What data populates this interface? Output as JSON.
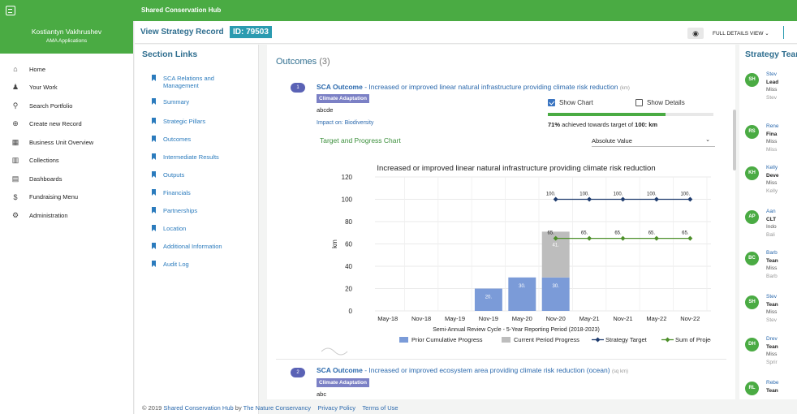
{
  "app": {
    "title": "Shared Conservation Hub"
  },
  "user": {
    "name": "Kostiantyn Vakhrushev",
    "role": "AMA Applications"
  },
  "nav": [
    {
      "label": "Home",
      "icon": "home-icon",
      "glyph": "⌂"
    },
    {
      "label": "Your Work",
      "icon": "person-icon",
      "glyph": "♟"
    },
    {
      "label": "Search Portfolio",
      "icon": "search-icon",
      "glyph": "⚲"
    },
    {
      "label": "Create new Record",
      "icon": "plus-circle-icon",
      "glyph": "⊕"
    },
    {
      "label": "Business Unit Overview",
      "icon": "org-chart-icon",
      "glyph": "▦"
    },
    {
      "label": "Collections",
      "icon": "collections-icon",
      "glyph": "▥"
    },
    {
      "label": "Dashboards",
      "icon": "dashboard-icon",
      "glyph": "▤"
    },
    {
      "label": "Fundraising Menu",
      "icon": "dollar-icon",
      "glyph": "$"
    },
    {
      "label": "Administration",
      "icon": "gear-icon",
      "glyph": "⚙"
    }
  ],
  "header": {
    "title": "View Strategy Record",
    "id_label": "ID: 79503",
    "view_label": "FULL DETAILS VIEW ⌄"
  },
  "section_links": {
    "title": "Section Links",
    "items": [
      "SCA Relations and Management",
      "Summary",
      "Strategic Pillars",
      "Outcomes",
      "Intermediate Results",
      "Outputs",
      "Financials",
      "Partnerships",
      "Location",
      "Additional Information",
      "Audit Log"
    ]
  },
  "outcomes": {
    "heading": "Outcomes",
    "count": "(3)",
    "items": [
      {
        "num": "1",
        "prefix": "SCA Outcome",
        "desc": " - Increased or improved linear natural infrastructure providing climate risk reduction",
        "unit": "(km)",
        "tag": "Climate Adaptation",
        "note": "abcde",
        "impact_label": "Impact on:",
        "impact_value": "Biodiversity",
        "show_chart": "Show Chart",
        "show_details": "Show Details",
        "progress_fraction": 0.71,
        "achieved_pct": "71%",
        "achieved_text": " achieved towards target of ",
        "achieved_target": "100: km",
        "chart_section": "Target and Progress Chart",
        "select_value": "Absolute Value"
      },
      {
        "num": "2",
        "prefix": "SCA Outcome",
        "desc": " - Increased or improved ecosystem area providing climate risk reduction (ocean)",
        "unit": "(sq km)",
        "tag": "Climate Adaptation",
        "note": "abc"
      }
    ]
  },
  "chart_data": {
    "type": "bar",
    "title": "Increased or improved linear natural infrastructure providing climate risk reduction",
    "xlabel": "Semi-Annual Review Cycle - 5-Year Reporting Period (2018-2023)",
    "ylabel": "km",
    "ylim": [
      0,
      120
    ],
    "yticks": [
      "0",
      "20",
      "40",
      "60",
      "80",
      "100",
      "120"
    ],
    "categories": [
      "May-18",
      "Nov-18",
      "May-19",
      "Nov-19",
      "May-20",
      "Nov-20",
      "May-21",
      "Nov-21",
      "May-22",
      "Nov-22"
    ],
    "series": [
      {
        "name": "Prior Cumulative Progress",
        "kind": "bar",
        "color": "#7b9bd8",
        "values": [
          null,
          null,
          null,
          20,
          30,
          30,
          null,
          null,
          null,
          null
        ],
        "labels": [
          "",
          "",
          "",
          "20.",
          "30.",
          "30.",
          "",
          "",
          "",
          ""
        ]
      },
      {
        "name": "Current Period Progress",
        "kind": "bar",
        "color": "#bdbdbd",
        "values": [
          null,
          null,
          null,
          null,
          null,
          41,
          null,
          null,
          null,
          null
        ],
        "labels": [
          "",
          "",
          "",
          "",
          "",
          "41.",
          "",
          "",
          "",
          ""
        ]
      },
      {
        "name": "Strategy Target",
        "kind": "line",
        "color": "#1f3c6e",
        "values": [
          null,
          null,
          null,
          null,
          null,
          100,
          100,
          100,
          100,
          100
        ],
        "labels": [
          "",
          "",
          "",
          "",
          "",
          "100.",
          "100.",
          "100.",
          "100.",
          "100."
        ]
      },
      {
        "name": "Sum of Project Targets",
        "kind": "line",
        "color": "#4d8f2a",
        "values": [
          null,
          null,
          null,
          null,
          null,
          65,
          65,
          65,
          65,
          65
        ],
        "labels": [
          "",
          "",
          "",
          "",
          "",
          "65.",
          "65.",
          "65.",
          "65.",
          "65."
        ]
      }
    ],
    "legend_position": "bottom",
    "grid": true
  },
  "team": {
    "title": "Strategy Team",
    "members": [
      {
        "initials": "SH",
        "name": "Stev",
        "role": "Lead",
        "org": "Miss",
        "email": "Stev"
      },
      {
        "initials": "RS",
        "name": "Rene",
        "role": "Fina",
        "org": "Miss",
        "email": "Miss"
      },
      {
        "initials": "KH",
        "name": "Kelly",
        "role": "Deve",
        "org": "Miss",
        "email": "Kelly"
      },
      {
        "initials": "AP",
        "name": "Aan",
        "role": "CLT",
        "org": "Indo",
        "email": "Bali"
      },
      {
        "initials": "BC",
        "name": "Barb",
        "role": "Tean",
        "org": "Miss",
        "email": "Barb"
      },
      {
        "initials": "SH",
        "name": "Stev",
        "role": "Tean",
        "org": "Miss",
        "email": "Stev"
      },
      {
        "initials": "DH",
        "name": "Drev",
        "role": "Tean",
        "org": "Miss",
        "email": "Sprir"
      },
      {
        "initials": "RL",
        "name": "Rebe",
        "role": "Tean",
        "org": "",
        "email": ""
      }
    ]
  },
  "footer": {
    "copyright": "© 2019 ",
    "hub": "Shared Conservation Hub",
    "by": " by ",
    "tnc": "The Nature Conservancy",
    "privacy": "Privacy Policy",
    "terms": "Terms of Use"
  }
}
